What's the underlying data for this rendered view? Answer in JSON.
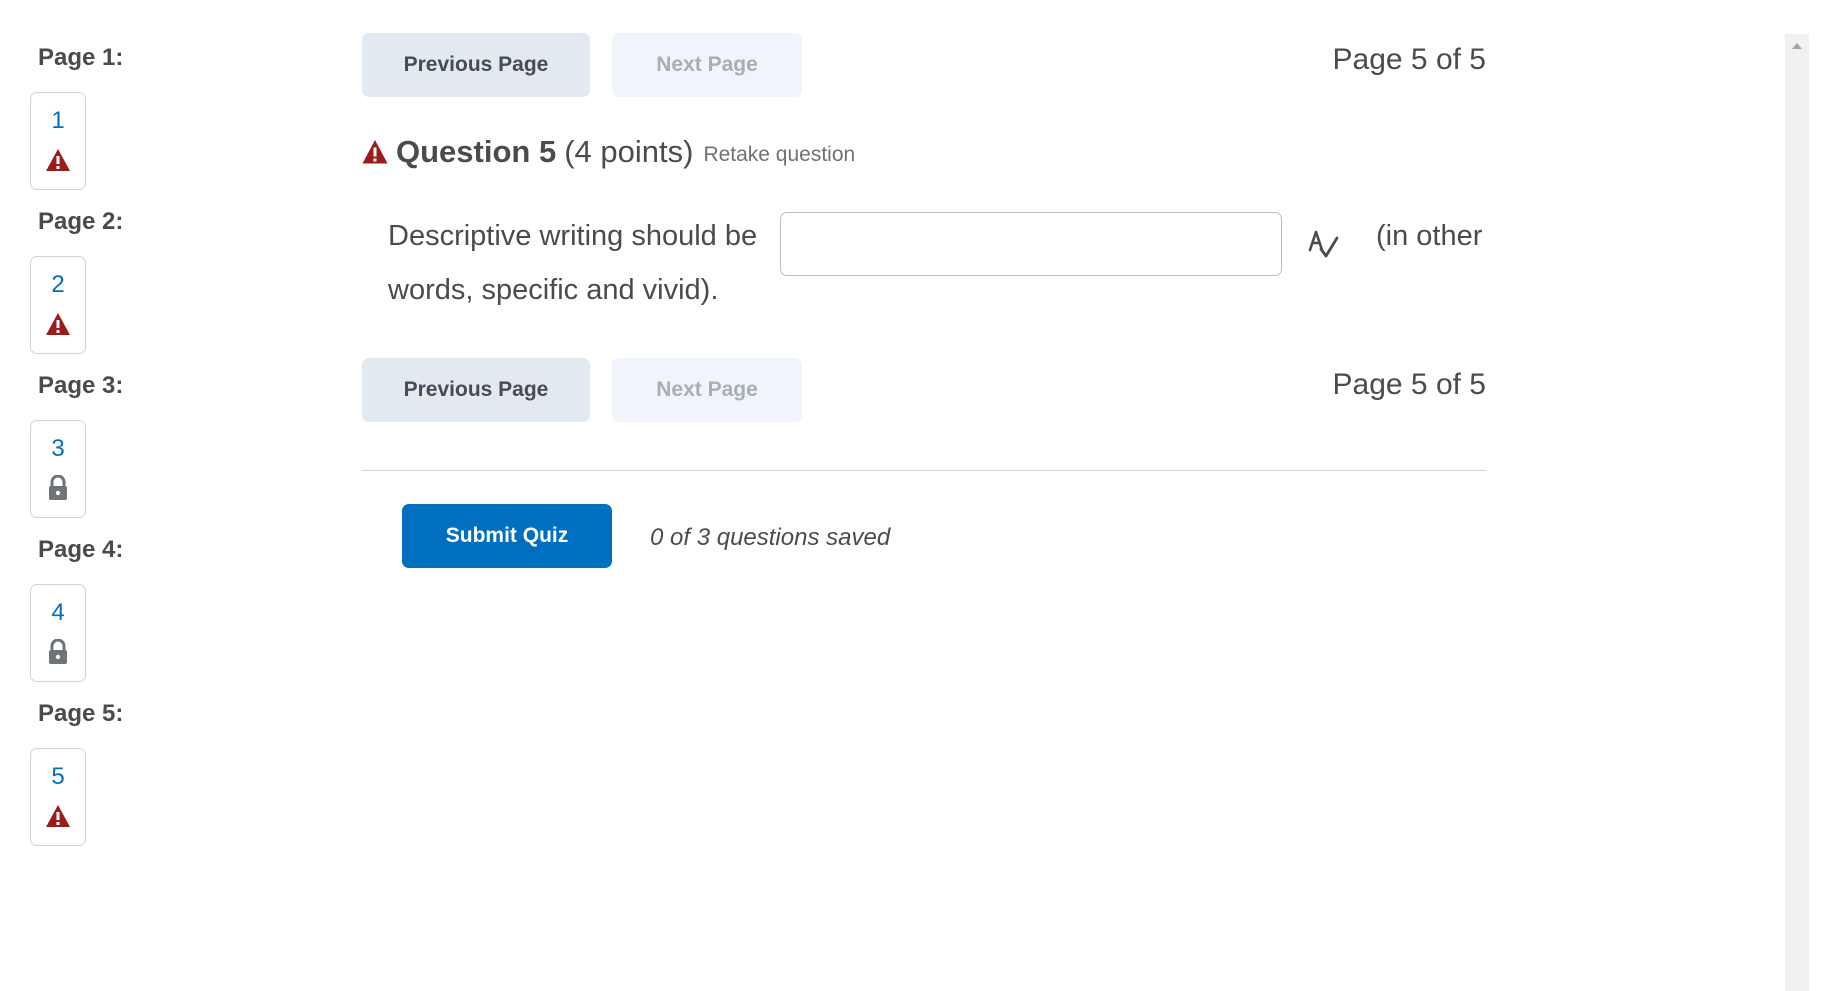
{
  "sidebar": {
    "pages": [
      {
        "label": "Page 1:",
        "question_number": "1",
        "status_icon": "warning-icon"
      },
      {
        "label": "Page 2:",
        "question_number": "2",
        "status_icon": "warning-icon"
      },
      {
        "label": "Page 3:",
        "question_number": "3",
        "status_icon": "lock-icon"
      },
      {
        "label": "Page 4:",
        "question_number": "4",
        "status_icon": "lock-icon"
      },
      {
        "label": "Page 5:",
        "question_number": "5",
        "status_icon": "warning-icon"
      }
    ]
  },
  "navigation": {
    "previous_label": "Previous Page",
    "next_label": "Next Page",
    "page_indicator": "Page 5 of 5"
  },
  "question": {
    "title": "Question 5",
    "points": "(4 points)",
    "retake_label": "Retake question",
    "text_before": "Descriptive writing should be",
    "text_after": "(in other",
    "text_continued": "words, specific and vivid).",
    "answer_value": "",
    "answer_placeholder": ""
  },
  "footer": {
    "submit_label": "Submit Quiz",
    "saved_status": "0 of 3 questions saved"
  },
  "colors": {
    "warning": "#9b1c1c",
    "lock": "#6e7376",
    "link": "#006fbf",
    "primary": "#006fbf",
    "secondary_button": "#e3e9f1",
    "disabled_button": "#f1f5fb"
  }
}
